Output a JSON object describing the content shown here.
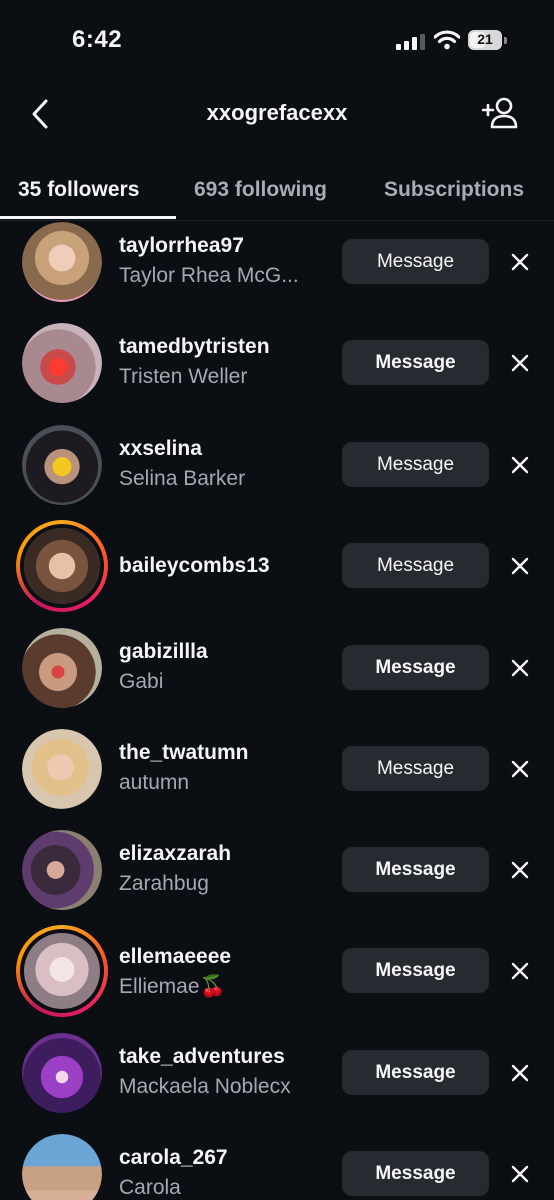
{
  "status_bar": {
    "time": "6:42",
    "battery_level": "21",
    "icons": [
      "cellular-signal-icon",
      "wifi-icon",
      "battery-icon"
    ]
  },
  "header": {
    "title": "xxogrefacexx",
    "back_icon": "chevron-left-icon",
    "add_icon": "add-person-icon"
  },
  "tabs": [
    {
      "label": "35 followers",
      "active": true
    },
    {
      "label": "693 following",
      "active": false
    },
    {
      "label": "Subscriptions",
      "active": false
    }
  ],
  "button_label": "Message",
  "followers": [
    {
      "username": "taylorrhea97",
      "full_name": "Taylor Rhea McG...",
      "has_story": false
    },
    {
      "username": "tamedbytristen",
      "full_name": "Tristen Weller",
      "has_story": false
    },
    {
      "username": "xxselina",
      "full_name": "Selina Barker",
      "has_story": false
    },
    {
      "username": "baileycombs13",
      "full_name": "",
      "has_story": true
    },
    {
      "username": "gabizillla",
      "full_name": "Gabi",
      "has_story": false
    },
    {
      "username": "the_twatumn",
      "full_name": "autumn",
      "has_story": false
    },
    {
      "username": "elizaxzarah",
      "full_name": "Zarahbug",
      "has_story": false
    },
    {
      "username": "ellemaeeee",
      "full_name": "Elliemae🍒",
      "has_story": true
    },
    {
      "username": "take_adventures",
      "full_name": "Mackaela Noblecx",
      "has_story": false
    },
    {
      "username": "carola_267",
      "full_name": "Carola",
      "has_story": false
    }
  ],
  "colors": {
    "background": "#0b0e13",
    "button_bg": "#262a31",
    "secondary_text": "#a3a8b2",
    "story_ring": "#f9a825"
  }
}
